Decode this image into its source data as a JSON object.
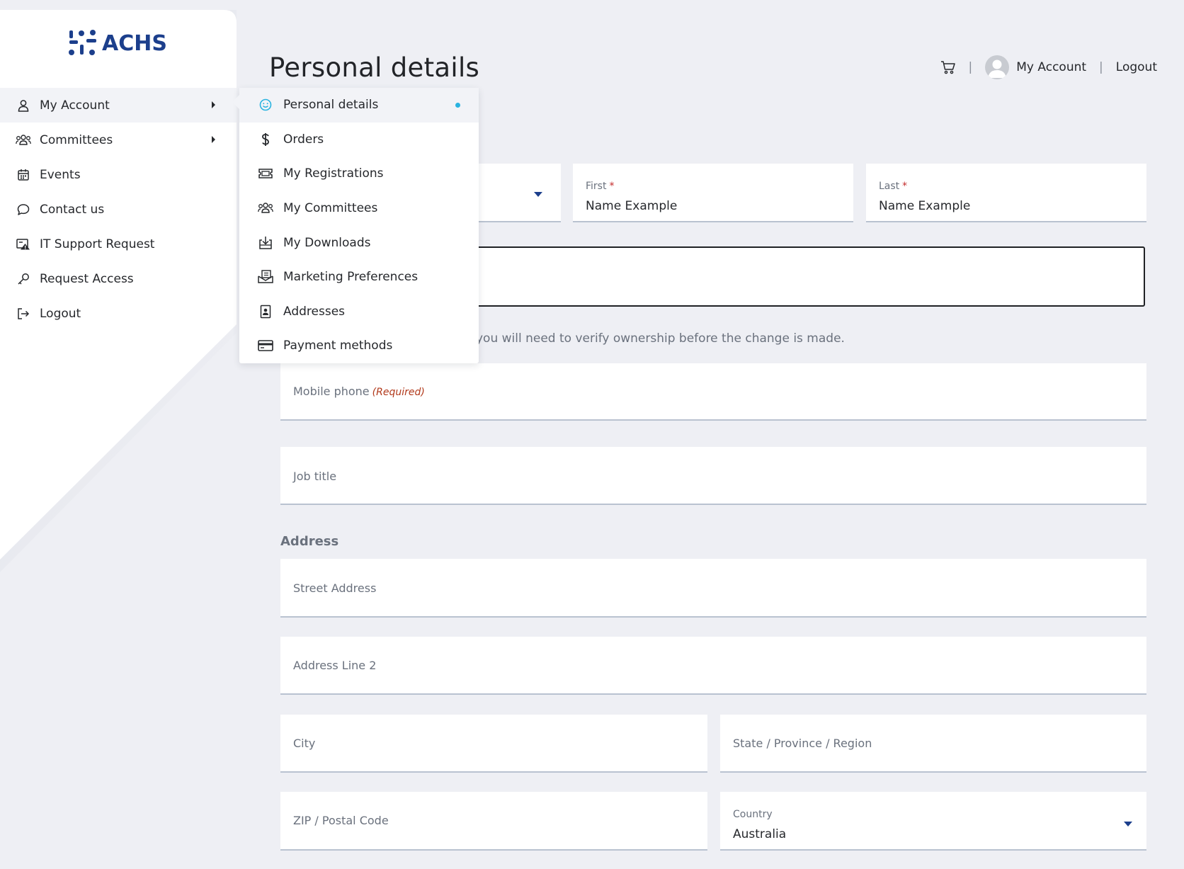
{
  "logo": {
    "text": "ACHS"
  },
  "sidebar": {
    "items": [
      {
        "label": "My Account",
        "icon": "user-icon",
        "has_submenu": true,
        "active": true
      },
      {
        "label": "Committees",
        "icon": "people-icon",
        "has_submenu": true
      },
      {
        "label": "Events",
        "icon": "calendar-icon"
      },
      {
        "label": "Contact us",
        "icon": "chat-icon"
      },
      {
        "label": "IT Support Request",
        "icon": "support-ticket-icon"
      },
      {
        "label": "Request Access",
        "icon": "key-icon"
      },
      {
        "label": "Logout",
        "icon": "logout-icon"
      }
    ]
  },
  "submenu": {
    "items": [
      {
        "label": "Personal details",
        "icon": "smiley-icon",
        "active": true
      },
      {
        "label": "Orders",
        "icon": "dollar-icon"
      },
      {
        "label": "My Registrations",
        "icon": "ticket-icon"
      },
      {
        "label": "My Committees",
        "icon": "people-icon"
      },
      {
        "label": "My Downloads",
        "icon": "download-icon"
      },
      {
        "label": "Marketing Preferences",
        "icon": "mail-icon"
      },
      {
        "label": "Addresses",
        "icon": "contact-card-icon"
      },
      {
        "label": "Payment methods",
        "icon": "credit-card-icon"
      }
    ]
  },
  "header": {
    "title": "Personal details",
    "account_label": "My Account",
    "logout_label": "Logout",
    "separator": "|"
  },
  "form": {
    "first": {
      "label": "First",
      "required_mark": "*",
      "value": "Name Example"
    },
    "last": {
      "label": "Last",
      "required_mark": "*",
      "value": "Name Example"
    },
    "email_help": "you will need to verify ownership before the change is made.",
    "mobile": {
      "placeholder": "Mobile phone",
      "required_text": "(Required)"
    },
    "job_title": {
      "placeholder": "Job title"
    },
    "address_heading": "Address",
    "street": {
      "placeholder": "Street Address"
    },
    "line2": {
      "placeholder": "Address Line 2"
    },
    "city": {
      "placeholder": "City"
    },
    "state": {
      "placeholder": "State / Province / Region"
    },
    "zip": {
      "placeholder": "ZIP / Postal Code"
    },
    "country": {
      "label": "Country",
      "value": "Australia"
    }
  },
  "colors": {
    "brand": "#1c3f8c",
    "accent_dot": "#2ab3e0",
    "required": "#c42d2d",
    "background": "#eeeff4"
  }
}
